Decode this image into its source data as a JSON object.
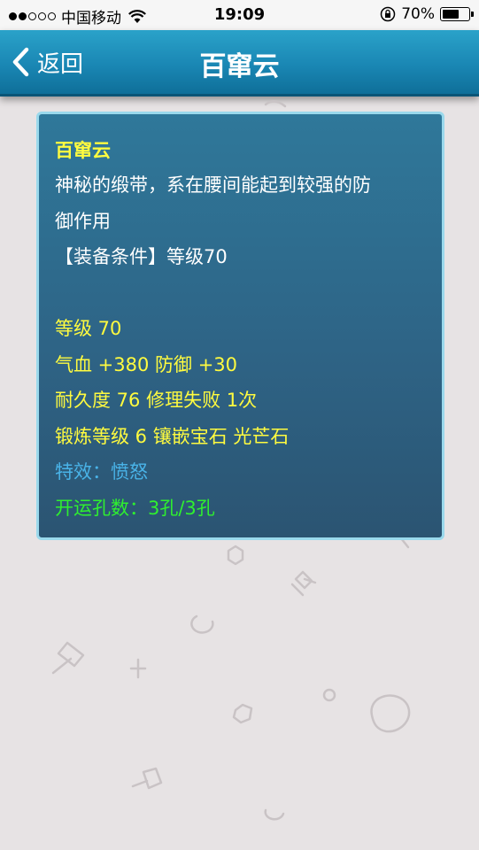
{
  "status_bar": {
    "carrier": "中国移动",
    "time": "19:09",
    "battery": "70%",
    "battery_level": 0.7,
    "signal_bars": 2,
    "signal_total": 5
  },
  "nav": {
    "back_label": "返回",
    "title": "百窜云"
  },
  "item": {
    "name": "百窜云",
    "description_line1": "神秘的缎带，系在腰间能起到较强的防",
    "description_line2": "御作用",
    "requirement": "【装备条件】等级70",
    "level": "等级 70",
    "stats": "气血 +380 防御 +30",
    "durability": "耐久度 76 修理失败 1次",
    "forging": "锻炼等级 6 镶嵌宝石 光芒石",
    "effect": "特效：愤怒",
    "holes": "开运孔数：3孔/3孔"
  },
  "colors": {
    "nav_bar": "#1a87b4",
    "card_background": "#2e6486",
    "card_border": "#9ad9ec",
    "title_yellow": "#fffb3f",
    "effect_cyan": "#49b3e8",
    "holes_green": "#2ff02f"
  },
  "icons": [
    "back-chevron-icon",
    "wifi-icon",
    "rotation-lock-icon",
    "battery-icon"
  ]
}
